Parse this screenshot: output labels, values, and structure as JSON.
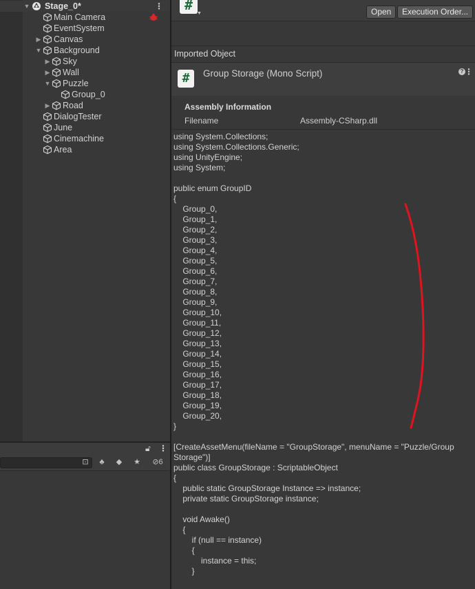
{
  "hierarchy": {
    "scene": "Stage_0*",
    "items": [
      {
        "label": "Main Camera",
        "depth": 0,
        "expandable": false
      },
      {
        "label": "EventSystem",
        "depth": 0,
        "expandable": false
      },
      {
        "label": "Canvas",
        "depth": 0,
        "expandable": true,
        "expanded": false
      },
      {
        "label": "Background",
        "depth": 0,
        "expandable": true,
        "expanded": true
      },
      {
        "label": "Sky",
        "depth": 1,
        "expandable": true,
        "expanded": false
      },
      {
        "label": "Wall",
        "depth": 1,
        "expandable": true,
        "expanded": false
      },
      {
        "label": "Puzzle",
        "depth": 1,
        "expandable": true,
        "expanded": true
      },
      {
        "label": "Group_0",
        "depth": 2,
        "expandable": false
      },
      {
        "label": "Road",
        "depth": 1,
        "expandable": true,
        "expanded": false
      },
      {
        "label": "DialogTester",
        "depth": 0,
        "expandable": false
      },
      {
        "label": "June",
        "depth": 0,
        "expandable": false
      },
      {
        "label": "Cinemachine",
        "depth": 0,
        "expandable": false
      },
      {
        "label": "Area",
        "depth": 0,
        "expandable": false
      }
    ]
  },
  "project": {
    "hidden_count": "6"
  },
  "inspector": {
    "open_label": "Open",
    "execution_order_label": "Execution Order...",
    "imported_object_label": "Imported Object",
    "object_title": "Group Storage (Mono Script)",
    "assembly": {
      "title": "Assembly Information",
      "filename_key": "Filename",
      "filename_value": "Assembly-CSharp.dll"
    },
    "code": "using System.Collections;\nusing System.Collections.Generic;\nusing UnityEngine;\nusing System;\n\npublic enum GroupID\n{\n    Group_0,\n    Group_1,\n    Group_2,\n    Group_3,\n    Group_4,\n    Group_5,\n    Group_6,\n    Group_7,\n    Group_8,\n    Group_9,\n    Group_10,\n    Group_11,\n    Group_12,\n    Group_13,\n    Group_14,\n    Group_15,\n    Group_16,\n    Group_17,\n    Group_18,\n    Group_19,\n    Group_20,\n}\n\n[CreateAssetMenu(fileName = \"GroupStorage\", menuName = \"Puzzle/Group Storage\")]\npublic class GroupStorage : ScriptableObject\n{\n    public static GroupStorage Instance => instance;\n    private static GroupStorage instance;\n\n    void Awake()\n    {\n        if (null == instance)\n        {\n            instance = this;\n        }"
  },
  "colors": {
    "annotation": "#e0141e",
    "script_icon_green": "#1f6b3a"
  }
}
